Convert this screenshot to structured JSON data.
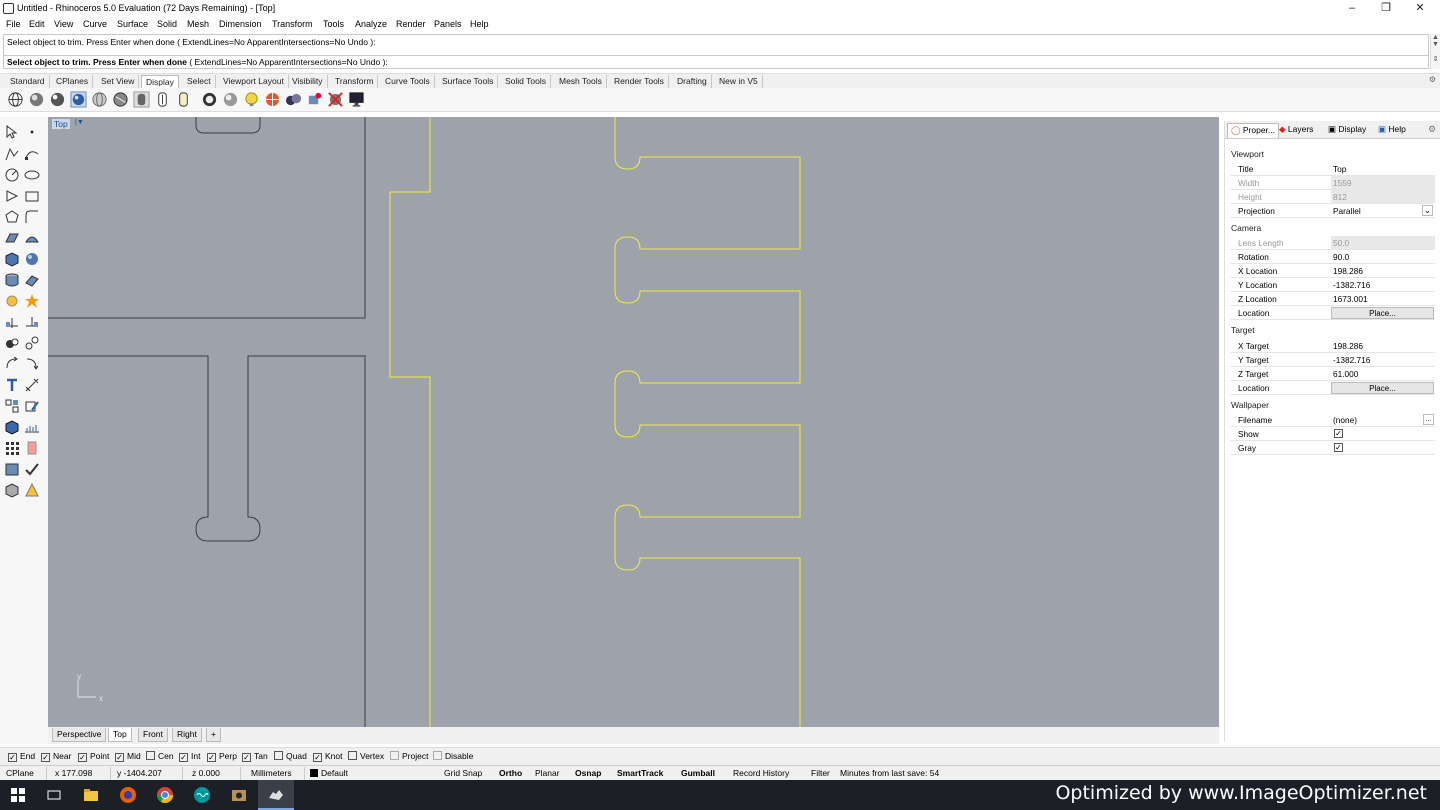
{
  "window": {
    "title": "Untitled - Rhinoceros 5.0 Evaluation (72 Days Remaining) - [Top]"
  },
  "menu": [
    "File",
    "Edit",
    "View",
    "Curve",
    "Surface",
    "Solid",
    "Mesh",
    "Dimension",
    "Transform",
    "Tools",
    "Analyze",
    "Render",
    "Panels",
    "Help"
  ],
  "command": {
    "history": "Select object to trim. Press Enter when done ( ExtendLines=No  ApparentIntersections=No  Undo ):",
    "prompt_bold": "Select object to trim. Press Enter when done",
    "prompt_options": " ( ExtendLines=No  ApparentIntersections=No  Undo ):"
  },
  "toolbar_tabs": [
    "Standard",
    "CPlanes",
    "Set View",
    "Display",
    "Select",
    "Viewport Layout",
    "Visibility",
    "Transform",
    "Curve Tools",
    "Surface Tools",
    "Solid Tools",
    "Mesh Tools",
    "Render Tools",
    "Drafting",
    "New in V5"
  ],
  "active_toolbar_tab": "Display",
  "viewport": {
    "label": "Top",
    "axis_x": "x",
    "axis_y": "y"
  },
  "viewport_tabs": [
    "Perspective",
    "Top",
    "Front",
    "Right"
  ],
  "active_viewport_tab": "Top",
  "viewport_tab_add": "+",
  "panel": {
    "tabs": [
      "Proper...",
      "Layers",
      "Display",
      "Help"
    ],
    "viewport_section": "Viewport",
    "title_label": "Title",
    "title_value": "Top",
    "width_label": "Width",
    "width_value": "1559",
    "height_label": "Height",
    "height_value": "812",
    "projection_label": "Projection",
    "projection_value": "Parallel",
    "camera_section": "Camera",
    "lens_label": "Lens Length",
    "lens_value": "50.0",
    "rotation_label": "Rotation",
    "rotation_value": "90.0",
    "xloc_label": "X Location",
    "xloc_value": "198.286",
    "yloc_label": "Y Location",
    "yloc_value": "-1382.716",
    "zloc_label": "Z Location",
    "zloc_value": "1673.001",
    "location_label": "Location",
    "place_label": "Place...",
    "target_section": "Target",
    "xtgt_label": "X Target",
    "xtgt_value": "198.286",
    "ytgt_label": "Y Target",
    "ytgt_value": "-1382.716",
    "ztgt_label": "Z Target",
    "ztgt_value": "61.000",
    "tlocation_label": "Location",
    "tplace_label": "Place...",
    "wallpaper_section": "Wallpaper",
    "filename_label": "Filename",
    "filename_value": "(none)",
    "browse_label": "...",
    "show_label": "Show",
    "show_checked": true,
    "gray_label": "Gray",
    "gray_checked": true
  },
  "osnaps": [
    {
      "label": "End",
      "checked": true
    },
    {
      "label": "Near",
      "checked": true
    },
    {
      "label": "Point",
      "checked": true
    },
    {
      "label": "Mid",
      "checked": true
    },
    {
      "label": "Cen",
      "checked": false
    },
    {
      "label": "Int",
      "checked": true
    },
    {
      "label": "Perp",
      "checked": true
    },
    {
      "label": "Tan",
      "checked": true
    },
    {
      "label": "Quad",
      "checked": false
    },
    {
      "label": "Knot",
      "checked": true
    },
    {
      "label": "Vertex",
      "checked": false
    },
    {
      "label": "Project",
      "checked": false
    },
    {
      "label": "Disable",
      "checked": false
    }
  ],
  "status": {
    "cplane": "CPlane",
    "x": "x 177.098",
    "y": "y -1404.207",
    "z": "z 0.000",
    "units": "Millimeters",
    "layer": "Default",
    "grid_snap": "Grid Snap",
    "ortho": "Ortho",
    "planar": "Planar",
    "osnap": "Osnap",
    "smarttrack": "SmartTrack",
    "gumball": "Gumball",
    "record_history": "Record History",
    "filter": "Filter",
    "minutes": "Minutes from last save: 54"
  },
  "taskbar": {
    "watermark": "Optimized by www.ImageOptimizer.net"
  },
  "colors": {
    "viewport_bg": "#9ea3ab",
    "curve_yellow": "#f2ee3a",
    "curve_dark": "#3a3d42",
    "accent": "#1a4f8a"
  }
}
